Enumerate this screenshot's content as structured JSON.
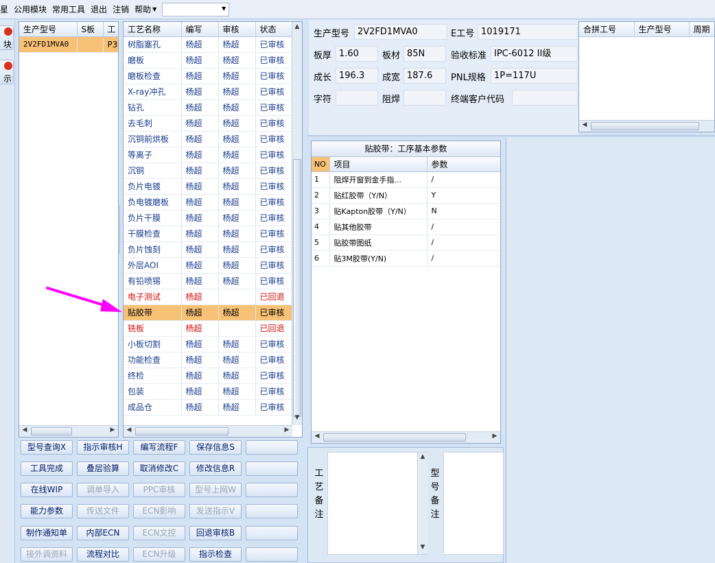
{
  "menu": {
    "items": [
      "星",
      "公用模块",
      "常用工具",
      "退出",
      "注销",
      "帮助"
    ],
    "dropdown_value": ""
  },
  "left_strip": {
    "buttons": [
      "块",
      "示"
    ]
  },
  "models_table": {
    "headers": [
      "生产型号",
      "S板",
      "工"
    ],
    "rows": [
      [
        "2V2FD1MVA0",
        "",
        "P3"
      ]
    ]
  },
  "process_table": {
    "headers": [
      "工艺名称",
      "编写",
      "审核",
      "状态"
    ],
    "selected_index": 17,
    "rows": [
      {
        "name": "树脂塞孔",
        "writer": "杨超",
        "reviewer": "杨超",
        "status": "已审核",
        "state": "ok"
      },
      {
        "name": "磨板",
        "writer": "杨超",
        "reviewer": "杨超",
        "status": "已审核",
        "state": "ok"
      },
      {
        "name": "磨板检查",
        "writer": "杨超",
        "reviewer": "杨超",
        "status": "已审核",
        "state": "ok"
      },
      {
        "name": "X-ray冲孔",
        "writer": "杨超",
        "reviewer": "杨超",
        "status": "已审核",
        "state": "ok"
      },
      {
        "name": "钻孔",
        "writer": "杨超",
        "reviewer": "杨超",
        "status": "已审核",
        "state": "ok"
      },
      {
        "name": "去毛刺",
        "writer": "杨超",
        "reviewer": "杨超",
        "status": "已审核",
        "state": "ok"
      },
      {
        "name": "沉铜前烘板",
        "writer": "杨超",
        "reviewer": "杨超",
        "status": "已审核",
        "state": "ok"
      },
      {
        "name": "等离子",
        "writer": "杨超",
        "reviewer": "杨超",
        "status": "已审核",
        "state": "ok"
      },
      {
        "name": "沉铜",
        "writer": "杨超",
        "reviewer": "杨超",
        "status": "已审核",
        "state": "ok"
      },
      {
        "name": "负片电镀",
        "writer": "杨超",
        "reviewer": "杨超",
        "status": "已审核",
        "state": "ok"
      },
      {
        "name": "负电镀磨板",
        "writer": "杨超",
        "reviewer": "杨超",
        "status": "已审核",
        "state": "ok"
      },
      {
        "name": "负片干膜",
        "writer": "杨超",
        "reviewer": "杨超",
        "status": "已审核",
        "state": "ok"
      },
      {
        "name": "干膜检查",
        "writer": "杨超",
        "reviewer": "杨超",
        "status": "已审核",
        "state": "ok"
      },
      {
        "name": "负片蚀刻",
        "writer": "杨超",
        "reviewer": "杨超",
        "status": "已审核",
        "state": "ok"
      },
      {
        "name": "外层AOI",
        "writer": "杨超",
        "reviewer": "杨超",
        "status": "已审核",
        "state": "ok"
      },
      {
        "name": "有铅喷锡",
        "writer": "杨超",
        "reviewer": "杨超",
        "status": "已审核",
        "state": "ok"
      },
      {
        "name": "电子测试",
        "writer": "杨超",
        "reviewer": "",
        "status": "已回退",
        "state": "rej"
      },
      {
        "name": "贴胶带",
        "writer": "杨超",
        "reviewer": "杨超",
        "status": "已审核",
        "state": "sel"
      },
      {
        "name": "铣板",
        "writer": "杨超",
        "reviewer": "",
        "status": "已回退",
        "state": "rej"
      },
      {
        "name": "小板切割",
        "writer": "杨超",
        "reviewer": "杨超",
        "status": "已审核",
        "state": "ok"
      },
      {
        "name": "功能检查",
        "writer": "杨超",
        "reviewer": "杨超",
        "status": "已审核",
        "state": "ok"
      },
      {
        "name": "终检",
        "writer": "杨超",
        "reviewer": "杨超",
        "status": "已审核",
        "state": "ok"
      },
      {
        "name": "包装",
        "writer": "杨超",
        "reviewer": "杨超",
        "status": "已审核",
        "state": "ok"
      },
      {
        "name": "成品仓",
        "writer": "杨超",
        "reviewer": "杨超",
        "status": "已审核",
        "state": "ok"
      }
    ]
  },
  "actions": [
    {
      "label": "型号查询X",
      "enabled": true
    },
    {
      "label": "指示审核H",
      "enabled": true
    },
    {
      "label": "编写流程F",
      "enabled": true
    },
    {
      "label": "保存信息S",
      "enabled": true
    },
    {
      "label": "",
      "enabled": true
    },
    {
      "label": "工具完成",
      "enabled": true
    },
    {
      "label": "叠层验算",
      "enabled": true
    },
    {
      "label": "取消修改C",
      "enabled": true
    },
    {
      "label": "修改信息R",
      "enabled": true
    },
    {
      "label": "",
      "enabled": true
    },
    {
      "label": "在线WIP",
      "enabled": true
    },
    {
      "label": "调单导入",
      "enabled": false
    },
    {
      "label": "PPC审核",
      "enabled": false
    },
    {
      "label": "型号上网W",
      "enabled": false
    },
    {
      "label": "",
      "enabled": true
    },
    {
      "label": "能力参数",
      "enabled": true
    },
    {
      "label": "传送文件",
      "enabled": false
    },
    {
      "label": "ECN影响",
      "enabled": false
    },
    {
      "label": "发送指示V",
      "enabled": false
    },
    {
      "label": "",
      "enabled": true
    },
    {
      "label": "制作通知单",
      "enabled": true
    },
    {
      "label": "内部ECN",
      "enabled": true
    },
    {
      "label": "ECN文控",
      "enabled": false
    },
    {
      "label": "回退审核B",
      "enabled": true
    },
    {
      "label": "",
      "enabled": true
    },
    {
      "label": "接外调资料",
      "enabled": false
    },
    {
      "label": "流程对比",
      "enabled": true
    },
    {
      "label": "ECN升级",
      "enabled": false
    },
    {
      "label": "指示检查",
      "enabled": true
    },
    {
      "label": "",
      "enabled": true
    }
  ],
  "info": {
    "model_label": "生产型号",
    "model": "2V2FD1MVA0",
    "ework_label": "E工号",
    "ework": "1019171",
    "thickness_label": "板厚",
    "thickness": "1.60",
    "material_label": "板材",
    "material": "85N",
    "standard_label": "验收标准",
    "standard": "IPC-6012 II级",
    "length_label": "成长",
    "length": "196.3",
    "width_label": "成宽",
    "width": "187.6",
    "pnl_label": "PNL规格",
    "pnl": "1P=117U",
    "char_label": "字符",
    "char": "",
    "mask_label": "阻焊",
    "mask": "",
    "customer_label": "终端客户代码",
    "customer": ""
  },
  "merge_table": {
    "headers": [
      "合拼工号",
      "生产型号",
      "周期"
    ]
  },
  "params": {
    "title": "贴胶带：工序基本参数",
    "headers": [
      "NO",
      "项目",
      "参数"
    ],
    "rows": [
      {
        "no": "1",
        "item": "阻焊开窗到金手指...",
        "value": "/"
      },
      {
        "no": "2",
        "item": "贴红胶带（Y/N）",
        "value": "Y"
      },
      {
        "no": "3",
        "item": "贴Kapton胶带（Y/N）",
        "value": "N"
      },
      {
        "no": "4",
        "item": "贴其他胶带",
        "value": "/"
      },
      {
        "no": "5",
        "item": "贴胶带图纸",
        "value": "/"
      },
      {
        "no": "6",
        "item": "贴3M胶带(Y/N)",
        "value": "/"
      }
    ]
  },
  "remarks": {
    "process_label": "工艺备注",
    "model_label": "型号备注",
    "process_text": "",
    "model_text": ""
  },
  "colors": {
    "accent": "#f8c276",
    "rejected": "#d01010",
    "text_blue": "#1a3d8c",
    "annotation_arrow": "#ff00ff"
  }
}
